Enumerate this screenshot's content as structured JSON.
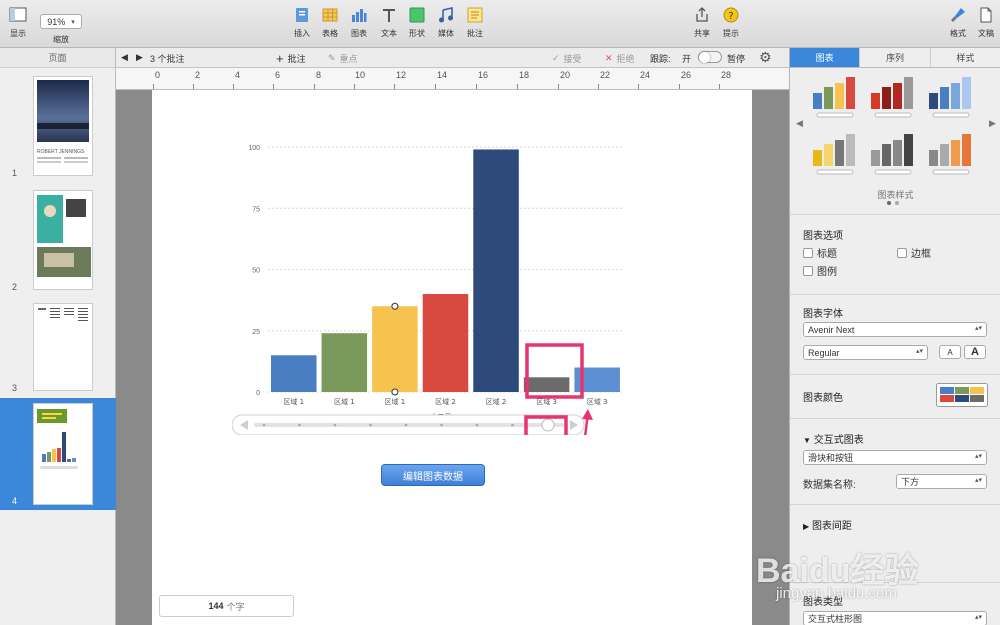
{
  "toolbar": {
    "view_label": "显示",
    "zoom_value": "91%",
    "zoom_label": "缩放",
    "insert_label": "插入",
    "table_label": "表格",
    "chart_label": "图表",
    "text_label": "文本",
    "shape_label": "形状",
    "media_label": "媒体",
    "comment_label": "批注",
    "share_label": "共享",
    "tips_label": "提示",
    "format_label": "格式",
    "document_label": "文稿"
  },
  "sidebar": {
    "title": "页面",
    "thumbnail_1_name": "ROBERT JENNINGS",
    "pages": [
      {
        "number": "1"
      },
      {
        "number": "2"
      },
      {
        "number": "3"
      },
      {
        "number": "4"
      }
    ],
    "selected_page": "4"
  },
  "comment_bar": {
    "comment_count": "3 个批注",
    "add_comment": "批注",
    "highlight": "重点",
    "accept": "接受",
    "reject": "拒绝",
    "tracking_label": "跟踪:",
    "on_label": "开",
    "pause_label": "暂停"
  },
  "ruler": {
    "ticks": [
      "0",
      "2",
      "4",
      "6",
      "8",
      "10",
      "12",
      "14",
      "16",
      "18",
      "20",
      "22",
      "24",
      "26",
      "28"
    ]
  },
  "chart_data": {
    "type": "bar",
    "categories": [
      "区域 1",
      "区域 1",
      "区域 1",
      "区域 2",
      "区域 2",
      "区域 3",
      "区域 3"
    ],
    "values": [
      15,
      24,
      35,
      40,
      99,
      6,
      10
    ],
    "colors": [
      "#4a7ec2",
      "#7a9a5c",
      "#f8c24f",
      "#d84a3f",
      "#2d4a7a",
      "#6b6b6b",
      "#5b8fd1"
    ],
    "xlabel": "十二月",
    "ylim": [
      0,
      100
    ],
    "yticks": [
      "0",
      "25",
      "50",
      "75",
      "100"
    ],
    "grid": true
  },
  "main": {
    "edit_chart_button": "编辑图表数据",
    "word_count": "144",
    "word_count_unit": "个字"
  },
  "inspector": {
    "tabs": [
      "图表",
      "序列",
      "样式"
    ],
    "active_tab": "图表",
    "chart_style_label": "图表样式",
    "chart_options_title": "图表选项",
    "option_title": "标题",
    "option_border": "边框",
    "option_legend": "图例",
    "chart_font_title": "图表字体",
    "font_family": "Avenir Next",
    "font_style": "Regular",
    "font_smaller": "A",
    "font_larger": "A",
    "chart_colors_title": "图表颜色",
    "interactive_title": "交互式图表",
    "interactive_mode": "滑块和按钮",
    "dataset_name_label": "数据集名称:",
    "dataset_position": "下方",
    "chart_spacing_title": "图表间距",
    "chart_type_title": "图表类型",
    "chart_type_value": "交互式柱形图"
  },
  "watermark": {
    "text": "Baidu经验",
    "url": "jingyan.baidu.com"
  },
  "colors": {
    "accent": "#3b87d9",
    "highlight_box": "#e8336f"
  }
}
